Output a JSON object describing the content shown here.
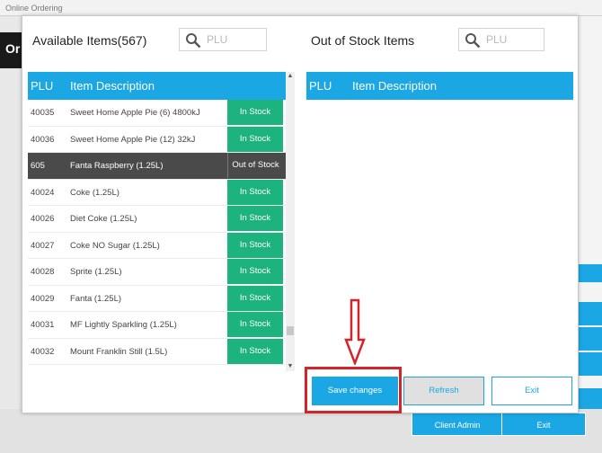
{
  "app": {
    "title": "Online Ordering",
    "sidebar_letters": "Or"
  },
  "background": {
    "client_admin": "Client Admin",
    "exit": "Exit"
  },
  "available": {
    "title": "Available Items(567)",
    "search_placeholder": "PLU",
    "col_plu": "PLU",
    "col_desc": "Item Description",
    "rows": [
      {
        "plu": "40035",
        "desc": "Sweet Home Apple Pie (6) 4800kJ",
        "status": "In Stock"
      },
      {
        "plu": "40036",
        "desc": "Sweet Home Apple Pie (12) 32kJ",
        "status": "In Stock"
      },
      {
        "plu": "605",
        "desc": "Fanta Raspberry (1.25L)",
        "status": "Out of Stock"
      },
      {
        "plu": "40024",
        "desc": "Coke (1.25L)",
        "status": "In Stock"
      },
      {
        "plu": "40026",
        "desc": "Diet Coke (1.25L)",
        "status": "In Stock"
      },
      {
        "plu": "40027",
        "desc": "Coke NO Sugar (1.25L)",
        "status": "In Stock"
      },
      {
        "plu": "40028",
        "desc": "Sprite (1.25L)",
        "status": "In Stock"
      },
      {
        "plu": "40029",
        "desc": "Fanta (1.25L)",
        "status": "In Stock"
      },
      {
        "plu": "40031",
        "desc": "MF Lightly Sparkling (1.25L)",
        "status": "In Stock"
      },
      {
        "plu": "40032",
        "desc": "Mount Franklin Still (1.5L)",
        "status": "In Stock"
      }
    ]
  },
  "out_of_stock": {
    "title": "Out of Stock Items",
    "search_placeholder": "PLU",
    "col_plu": "PLU",
    "col_desc": "Item Description"
  },
  "buttons": {
    "save": "Save changes",
    "refresh": "Refresh",
    "exit": "Exit"
  },
  "colors": {
    "accent": "#1ba7e3",
    "in_stock": "#1db37f",
    "selected_row": "#4a4a4a",
    "highlight": "#d4242a"
  }
}
